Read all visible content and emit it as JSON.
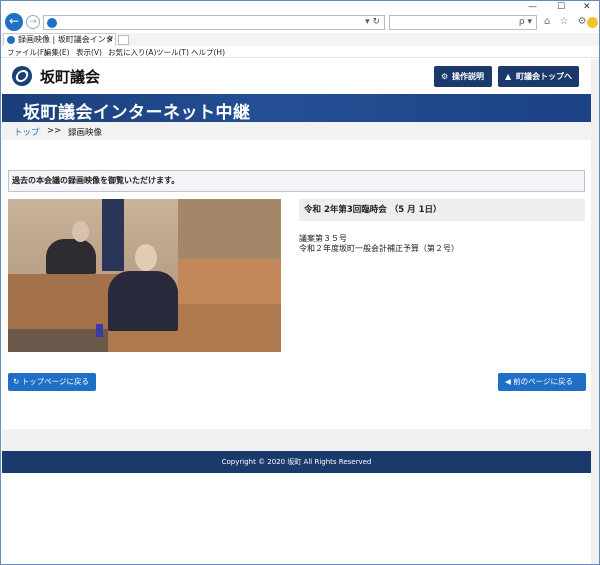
{
  "browser": {
    "window_controls": {
      "minimize": "—",
      "maximize": "☐",
      "close": "✕"
    },
    "address": {
      "value": "",
      "controls": "▾ ↻"
    },
    "search": {
      "value": "",
      "controls": "ρ ▾"
    },
    "toolbar_icons": "⌂ ☆ ⚙",
    "tab": {
      "label": "録画映像 | 坂町議会インター...",
      "close": "✕"
    },
    "menu": [
      "ファイル(F)",
      "編集(E)",
      "表示(V)",
      "お気に入り(A)",
      "ツール(T)",
      "ヘルプ(H)"
    ]
  },
  "site": {
    "title": "坂町議会",
    "buttons": {
      "help": {
        "label": "操作説明",
        "icon": "gear-icon"
      },
      "top": {
        "label": "町議会トップへ",
        "icon": "chart-icon"
      }
    },
    "banner_title": "坂町議会インターネット中継"
  },
  "breadcrumb": {
    "home": "トップ",
    "sep": ">>",
    "current": "録画映像"
  },
  "notice": "過去の本会議の録画映像を御覧いただけます。",
  "session": {
    "heading": "令和 2年第3回臨時会 （5 月 1日）",
    "bill_no": "議案第３５号",
    "bill_title": "令和２年度坂町一般会計補正予算（第２号）"
  },
  "nav_buttons": {
    "top_page": "トップページに戻る",
    "prev_page": "前のページに戻る"
  },
  "footer": "Copyright © 2020 坂町 All Rights Reserved",
  "colors": {
    "navy": "#1a3a6c",
    "button_blue": "#1f6fc7"
  }
}
